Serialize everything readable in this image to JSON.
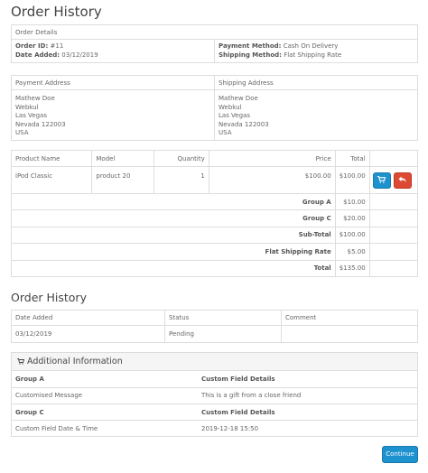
{
  "page_title": "Order History",
  "details": {
    "heading": "Order Details",
    "order_id_label": "Order ID:",
    "order_id": "#11",
    "date_added_label": "Date Added:",
    "date_added": "03/12/2019",
    "payment_method_label": "Payment Method:",
    "payment_method": "Cash On Delivery",
    "shipping_method_label": "Shipping Method:",
    "shipping_method": "Flat Shipping Rate"
  },
  "addresses": {
    "payment_heading": "Payment Address",
    "shipping_heading": "Shipping Address",
    "payment": [
      "Mathew Doe",
      "Webkul",
      "Las Vegas",
      "Nevada 122003",
      "USA"
    ],
    "shipping": [
      "Mathew Doe",
      "Webkul",
      "Las Vegas",
      "Nevada 122003",
      "USA"
    ]
  },
  "products": {
    "headers": [
      "Product Name",
      "Model",
      "Quantity",
      "Price",
      "Total"
    ],
    "rows": [
      {
        "name": "iPod Classic",
        "model": "product 20",
        "quantity": "1",
        "price": "$100.00",
        "total": "$100.00"
      }
    ],
    "totals": [
      {
        "label": "Group A",
        "value": "$10.00"
      },
      {
        "label": "Group C",
        "value": "$20.00"
      },
      {
        "label": "Sub-Total",
        "value": "$100.00"
      },
      {
        "label": "Flat Shipping Rate",
        "value": "$5.00"
      },
      {
        "label": "Total",
        "value": "$135.00"
      }
    ],
    "reorder_icon": "shopping-cart-icon",
    "return_icon": "reply-icon"
  },
  "history": {
    "title": "Order History",
    "headers": [
      "Date Added",
      "Status",
      "Comment"
    ],
    "rows": [
      {
        "date": "03/12/2019",
        "status": "Pending",
        "comment": ""
      }
    ]
  },
  "additional": {
    "title": "Additional Information",
    "icon": "shopping-cart-icon",
    "rows": [
      {
        "left": "Group A",
        "right": "Custom Field Details",
        "bold": true
      },
      {
        "left": "Customised Message",
        "right": "This is a gift from a close friend",
        "bold": false
      },
      {
        "left": "Group C",
        "right": "Custom Field Details",
        "bold": true
      },
      {
        "left": "Custom Field Date & Time",
        "right": "2019-12-18 15:50",
        "bold": false
      }
    ]
  },
  "continue_label": "Continue",
  "colors": {
    "primary": "#1e91cf",
    "danger": "#dc4a33",
    "border": "#dddddd"
  }
}
